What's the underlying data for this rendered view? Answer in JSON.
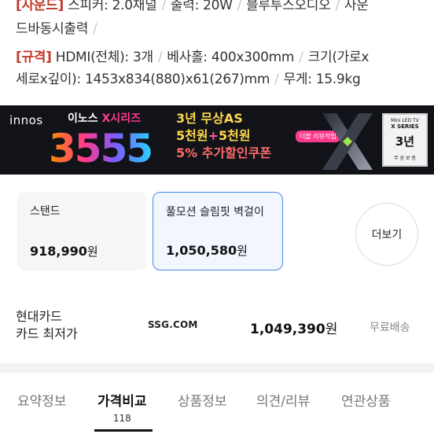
{
  "specs": {
    "line1": {
      "tag": "[사운드]",
      "items": [
        "스피커: 2.0채널",
        "출력: 20W",
        "블루투스오디오",
        "사운"
      ]
    },
    "line2": {
      "text": "드바동시출력",
      "sep": "/"
    },
    "line3": {
      "tag": "[규격]",
      "items": [
        "HDMI(전체): 3개",
        "베사홀: 400x300mm",
        "크기(가로x"
      ]
    },
    "line4": {
      "items": [
        "세로x깊이): 1453x834(880)x61(267)mm",
        "무게: 15.9kg"
      ]
    },
    "separator": "/"
  },
  "banner": {
    "brand": "innos",
    "series_prefix": "이노스 ",
    "series_name": "X시리즈",
    "big_number": "3555",
    "promo_line1": "3년 무상AS",
    "promo_line2_a": "5천원",
    "promo_line2_plus": "+",
    "promo_line2_b": "5천원",
    "promo_line3": "5% 추가할인쿠폰",
    "badge": "더블 리뷰적립",
    "warranty_top": "Mini LED TV",
    "warranty_series": "X SERIES",
    "warranty_years": "3년",
    "warranty_bottom": "무 상 보 증"
  },
  "options": [
    {
      "name": "스탠드",
      "price": "918,990",
      "unit": "원"
    },
    {
      "name": "풀모션 슬림핏 벽걸이",
      "price": "1,050,580",
      "unit": "원"
    }
  ],
  "more_button": "더보기",
  "offer": {
    "card_line1": "현대카드",
    "card_line2": "카드 최저가",
    "mall": "SSG.COM",
    "price": "1,049,390",
    "unit": "원",
    "shipping": "무료배송"
  },
  "tabs": [
    {
      "label": "요약정보"
    },
    {
      "label": "가격비교",
      "count": "118"
    },
    {
      "label": "상품정보"
    },
    {
      "label": "의견/리뷰"
    },
    {
      "label": "연관상품"
    }
  ],
  "colors": {
    "spec_tag": "#c0392b",
    "selected_border": "#4a86e8",
    "banner_bg": "#111318",
    "promo_yellow": "#ffd84a"
  }
}
